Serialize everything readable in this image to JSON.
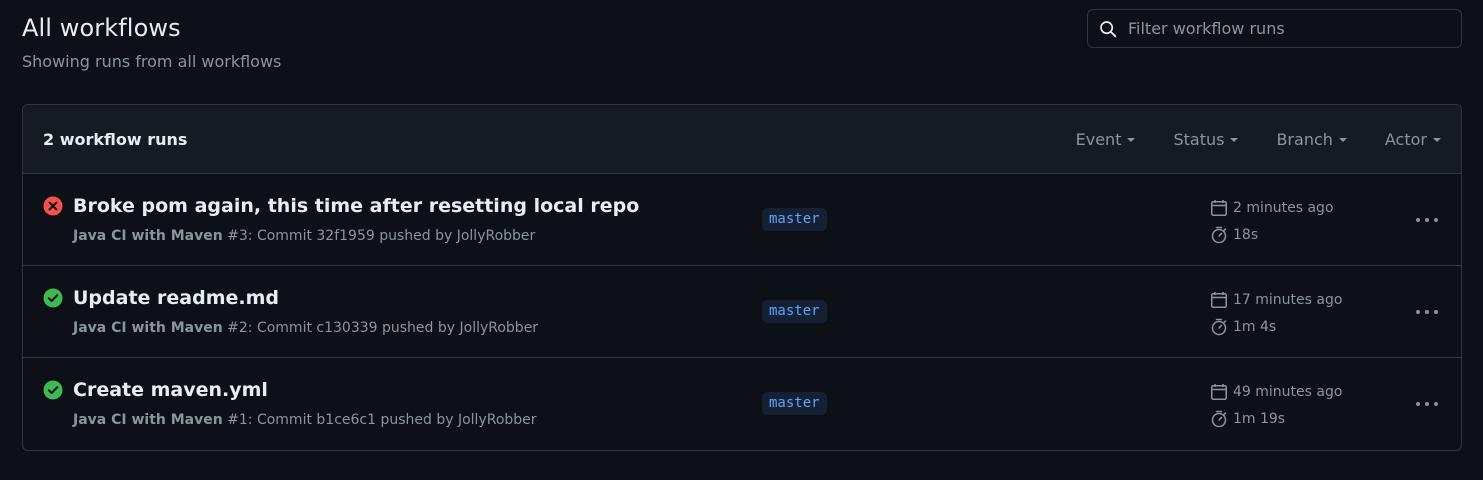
{
  "header": {
    "title": "All workflows",
    "subtitle": "Showing runs from all workflows"
  },
  "search": {
    "placeholder": "Filter workflow runs",
    "value": ""
  },
  "list": {
    "count_label": "2 workflow runs",
    "filters": [
      {
        "label": "Event"
      },
      {
        "label": "Status"
      },
      {
        "label": "Branch"
      },
      {
        "label": "Actor"
      }
    ]
  },
  "runs": [
    {
      "status": "failure",
      "status_icon": "x-circle-fill-icon",
      "title": "Broke pom again, this time after resetting local repo",
      "workflow": "Java CI with Maven",
      "detail": " #3: Commit 32f1959 pushed by JollyRobber",
      "branch": "master",
      "when": "2 minutes ago",
      "duration": "18s"
    },
    {
      "status": "success",
      "status_icon": "check-circle-fill-icon",
      "title": "Update readme.md",
      "workflow": "Java CI with Maven",
      "detail": " #2: Commit c130339 pushed by JollyRobber",
      "branch": "master",
      "when": "17 minutes ago",
      "duration": "1m 4s"
    },
    {
      "status": "success",
      "status_icon": "check-circle-fill-icon",
      "title": "Create maven.yml",
      "workflow": "Java CI with Maven",
      "detail": " #1: Commit b1ce6c1 pushed by JollyRobber",
      "branch": "master",
      "when": "49 minutes ago",
      "duration": "1m 19s"
    }
  ],
  "colors": {
    "background": "#0d1117",
    "header_bg": "#161b22",
    "border": "#30363d",
    "text": "#e6edf3",
    "muted": "#8b949e",
    "success": "#3fb950",
    "failure": "#f85149",
    "branch_text": "#58a6ff",
    "branch_bg": "#152033"
  }
}
